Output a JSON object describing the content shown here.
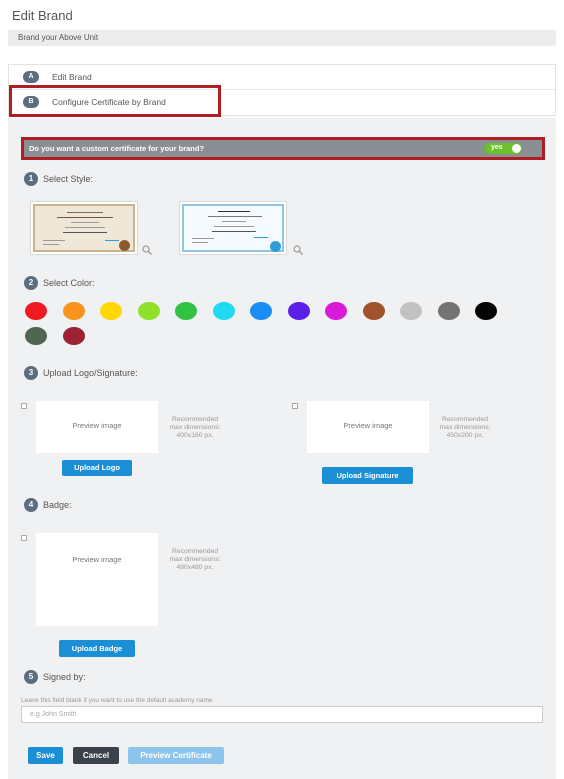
{
  "page": {
    "title": "Edit Brand",
    "subtitle": "Brand your Above Unit"
  },
  "accordion": [
    {
      "letter": "A",
      "label": "Edit Brand"
    },
    {
      "letter": "B",
      "label": "Configure Certificate by Brand"
    }
  ],
  "custom_certificate": {
    "question": "Do you want a custom certificate for your brand?",
    "toggle_label": "yes",
    "toggle_on": true
  },
  "sections": {
    "style": {
      "num": "1",
      "title": "Select Style:"
    },
    "color": {
      "num": "2",
      "title": "Select Color:"
    },
    "upload": {
      "num": "3",
      "title": "Upload Logo/Signature:"
    },
    "badge": {
      "num": "4",
      "title": "Badge:"
    },
    "signed": {
      "num": "5",
      "title": "Signed by:"
    }
  },
  "styles": [
    {
      "name": "classic-parchment",
      "accent": "#8a5a2b"
    },
    {
      "name": "modern-blue",
      "accent": "#2b9ed8"
    }
  ],
  "colors": [
    "#ef1b23",
    "#f7931e",
    "#ffd800",
    "#8fe02a",
    "#31c341",
    "#1fdaf0",
    "#1a8ef5",
    "#5b1fe8",
    "#d91ad9",
    "#a0522d",
    "#c2c2c2",
    "#737373",
    "#050505",
    "#4e6652",
    "#9b2335"
  ],
  "uploads": {
    "logo": {
      "preview_text": "Preview image",
      "rec_line1": "Recommended",
      "rec_line2": "max dimensions:",
      "rec_line3": "400x160 px.",
      "button": "Upload Logo"
    },
    "signature": {
      "preview_text": "Preview image",
      "rec_line1": "Recommended",
      "rec_line2": "max dimensions:",
      "rec_line3": "450x200 px.",
      "button": "Upload Signature"
    },
    "badge": {
      "preview_text": "Preview image",
      "rec_line1": "Recommended",
      "rec_line2": "max dimensions:",
      "rec_line3": "480x480 px.",
      "button": "Upload Badge"
    }
  },
  "signed_by": {
    "hint": "Leave this field blank if you want to use the default academy name",
    "placeholder": "e.g John Smith",
    "value": ""
  },
  "actions": {
    "save": "Save",
    "cancel": "Cancel",
    "preview": "Preview Certificate"
  }
}
